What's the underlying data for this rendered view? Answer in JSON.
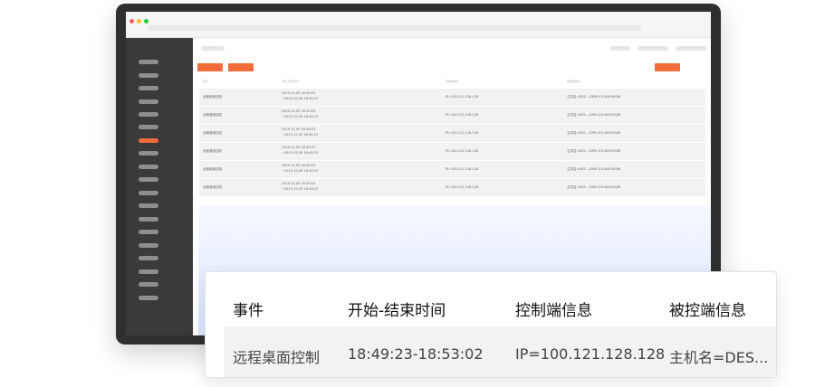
{
  "colors": {
    "accent": "#f26b3a",
    "sidebar": "#3a3a3a",
    "bezel": "#2f2f2f"
  },
  "window_controls": [
    {
      "name": "close",
      "color": "#ff5f57"
    },
    {
      "name": "minimize",
      "color": "#febc2e"
    },
    {
      "name": "maximize",
      "color": "#28c840"
    }
  ],
  "sidebar": {
    "item_count": 19,
    "active_index": 6
  },
  "mini_table": {
    "headers": [
      "事件",
      "开始-结束时间",
      "控制端信息",
      "被控端信息"
    ],
    "rows": [
      {
        "event": "远程桌面控制",
        "start": "2019-12-09 18:49:23",
        "end": "~2019-12-09 18:49:23",
        "controller": "IP=100.121.128.128",
        "controlled": "主机名=DES....DEM-20140630GJW"
      },
      {
        "event": "远程桌面控制",
        "start": "2019-12-09 18:49:23",
        "end": "~2019-12-09 18:49:23",
        "controller": "IP=100.121.128.128",
        "controlled": "主机名=DES....DEM-20140630GJW"
      },
      {
        "event": "远程桌面控制",
        "start": "2019-12-09 18:49:23",
        "end": "~2019-12-09 18:49:23",
        "controller": "IP=100.121.128.128",
        "controlled": "主机名=DES....DEM-20140630GJW"
      },
      {
        "event": "远程桌面控制",
        "start": "2019-12-09 18:49:23",
        "end": "~2019-12-09 18:49:23",
        "controller": "IP=100.121.128.128",
        "controlled": "主机名=DES....DEM-20140630GJW"
      },
      {
        "event": "远程桌面控制",
        "start": "2019-12-09 18:49:23",
        "end": "~2019-12-09 18:49:23",
        "controller": "IP=100.121.128.128",
        "controlled": "主机名=DES....DEM-20140630GJW"
      },
      {
        "event": "远程桌面控制",
        "start": "2019-12-09 18:49:23",
        "end": "~2019-12-09 18:49:23",
        "controller": "IP=100.121.128.128",
        "controlled": "主机名=DES....DEM-20140630GJW"
      }
    ]
  },
  "zoom_card": {
    "headers": {
      "event": "事件",
      "time": "开始-结束时间",
      "controller": "控制端信息",
      "controlled": "被控端信息"
    },
    "row": {
      "event": "远程桌面控制",
      "time": "18:49:23-18:53:02",
      "controller": "IP=100.121.128.128",
      "controlled": "主机名=DES..."
    }
  }
}
